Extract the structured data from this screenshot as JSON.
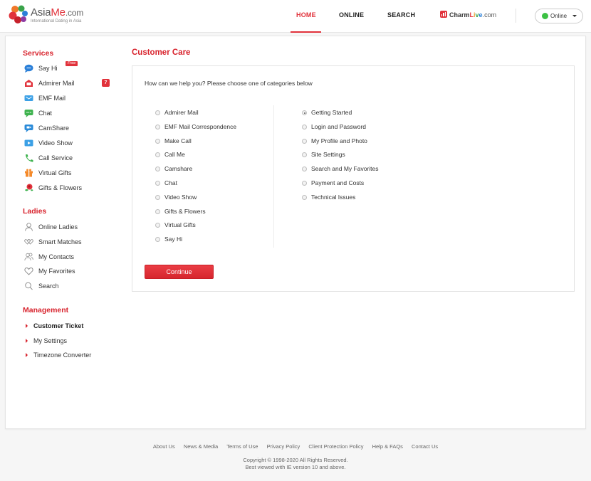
{
  "brand": {
    "name_part1": "Asia",
    "name_part2": "Me",
    "name_part3": ".com",
    "tagline": "International Dating in Asia"
  },
  "nav": {
    "items": [
      {
        "label": "HOME",
        "active": true
      },
      {
        "label": "ONLINE",
        "active": false
      },
      {
        "label": "SEARCH",
        "active": false
      }
    ],
    "charmlive": {
      "p1": "Charm",
      "l": "L",
      "i": "i",
      "v": "v",
      "e": "e",
      "com": ".com"
    },
    "status": {
      "label": "Online",
      "color": "#3cc144"
    }
  },
  "sidebar": {
    "services_heading": "Services",
    "services": [
      {
        "label": "Say Hi",
        "icon": "chat-bubble-icon",
        "badge": "Free"
      },
      {
        "label": "Admirer Mail",
        "icon": "envelope-open-icon",
        "count": "7"
      },
      {
        "label": "EMF Mail",
        "icon": "mail-icon"
      },
      {
        "label": "Chat",
        "icon": "chat-icon"
      },
      {
        "label": "CamShare",
        "icon": "camera-icon"
      },
      {
        "label": "Video Show",
        "icon": "video-play-icon"
      },
      {
        "label": "Call Service",
        "icon": "phone-icon"
      },
      {
        "label": "Virtual Gifts",
        "icon": "gift-icon"
      },
      {
        "label": "Gifts & Flowers",
        "icon": "rose-icon"
      }
    ],
    "ladies_heading": "Ladies",
    "ladies": [
      {
        "label": "Online Ladies",
        "icon": "person-icon"
      },
      {
        "label": "Smart Matches",
        "icon": "linked-hearts-icon"
      },
      {
        "label": "My Contacts",
        "icon": "contacts-icon"
      },
      {
        "label": "My Favorites",
        "icon": "heart-icon"
      },
      {
        "label": "Search",
        "icon": "search-icon"
      }
    ],
    "management_heading": "Management",
    "management": [
      {
        "label": "Customer Ticket",
        "active": true
      },
      {
        "label": "My Settings",
        "active": false
      },
      {
        "label": "Timezone Converter",
        "active": false
      }
    ]
  },
  "main": {
    "title": "Customer Care",
    "prompt": "How can we help you? Please choose one of categories below",
    "left_options": [
      "Admirer Mail",
      "EMF Mail Correspondence",
      "Make Call",
      "Call Me",
      "Camshare",
      "Chat",
      "Video Show",
      "Gifts & Flowers",
      "Virtual Gifts",
      "Say Hi"
    ],
    "right_options": [
      "Getting Started",
      "Login and Password",
      "My Profile and Photo",
      "Site Settings",
      "Search and My Favorites",
      "Payment and Costs",
      "Technical Issues"
    ],
    "selected": "Getting Started",
    "continue_label": "Continue",
    "accent": "#d8242e"
  },
  "footer": {
    "links": [
      "About Us",
      "News & Media",
      "Terms of Use",
      "Privacy Policy",
      "Client Protection Policy",
      "Help & FAQs",
      "Contact Us"
    ],
    "copyright": "Copyright © 1998-2020 All Rights Reserved.",
    "browser_note": "Best viewed with IE version 10 and above."
  }
}
